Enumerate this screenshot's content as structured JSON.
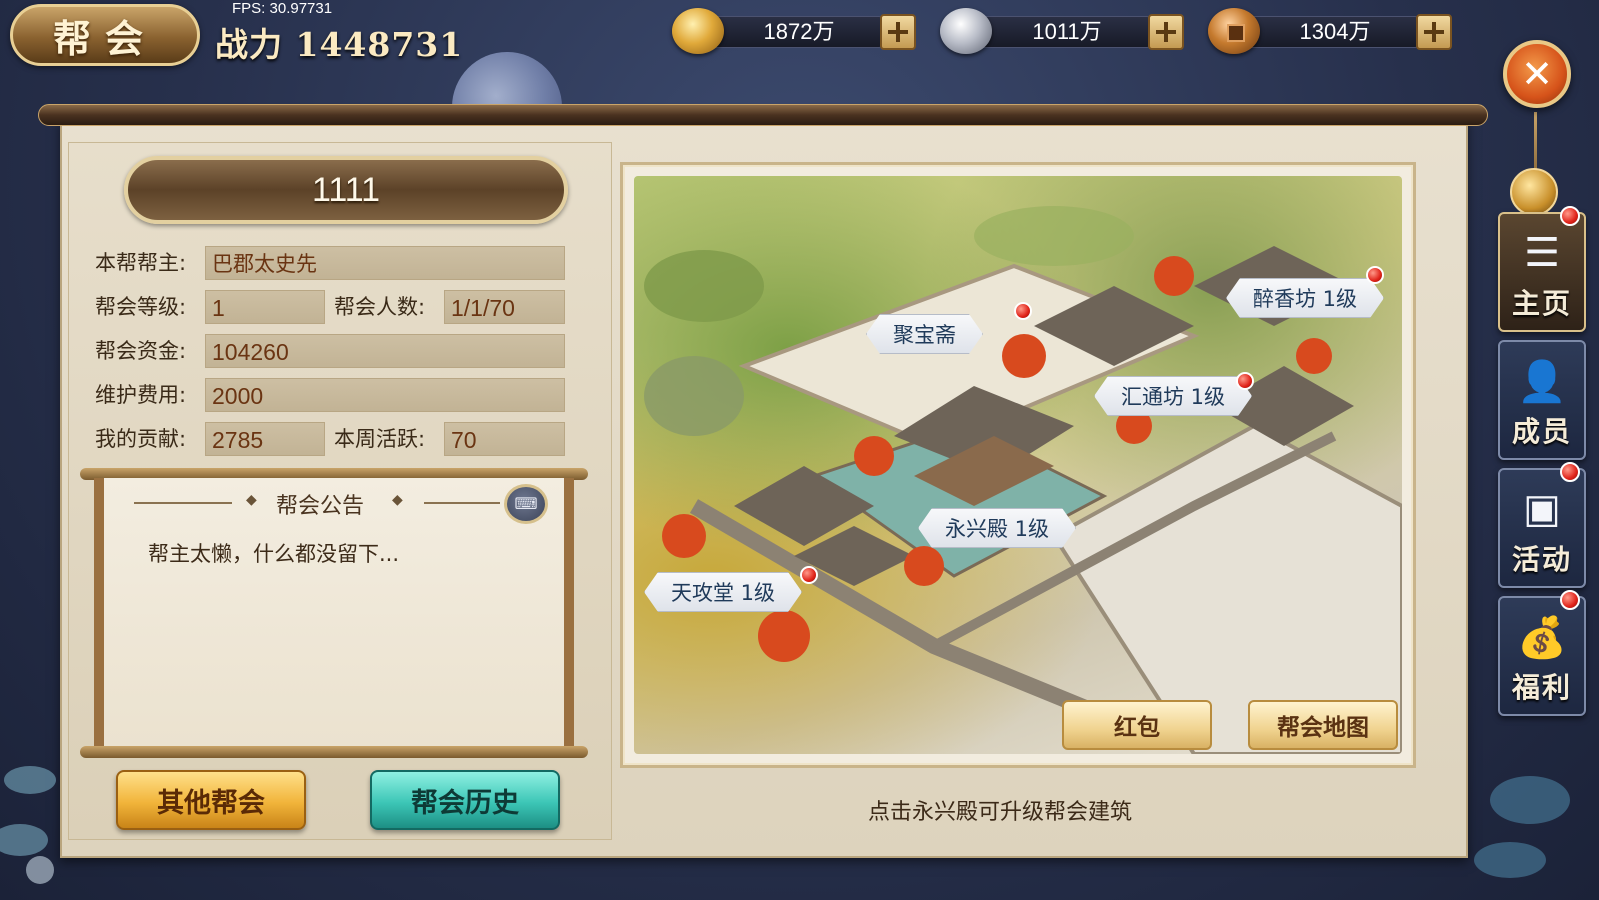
{
  "header": {
    "title": "帮会",
    "fps": "FPS: 30.97731",
    "power_label": "战力",
    "power_value": "1448731"
  },
  "currencies": [
    {
      "icon": "gold-ingot-icon",
      "value": "1872万"
    },
    {
      "icon": "silver-ingot-icon",
      "value": "1011万"
    },
    {
      "icon": "copper-coin-icon",
      "value": "1304万"
    }
  ],
  "guild": {
    "name": "1111",
    "leader_label": "本帮帮主:",
    "leader": "巴郡太史先",
    "level_label": "帮会等级:",
    "level": "1",
    "members_label": "帮会人数:",
    "members": "1/1/70",
    "funds_label": "帮会资金:",
    "funds": "104260",
    "upkeep_label": "维护费用:",
    "upkeep": "2000",
    "contribution_label": "我的贡献:",
    "contribution": "2785",
    "weekly_label": "本周活跃:",
    "weekly": "70"
  },
  "notice": {
    "title": "帮会公告",
    "text": "帮主太懒，什么都没留下..."
  },
  "buttons": {
    "other_guilds": "其他帮会",
    "guild_history": "帮会历史",
    "red_packet": "红包",
    "guild_map": "帮会地图"
  },
  "buildings": [
    {
      "name": "醉香坊 1级",
      "badge": true
    },
    {
      "name": "聚宝斋",
      "badge": true
    },
    {
      "name": "汇通坊 1级",
      "badge": true
    },
    {
      "name": "永兴殿 1级",
      "badge": false
    },
    {
      "name": "天攻堂 1级",
      "badge": true
    }
  ],
  "tip": "点击永兴殿可升级帮会建筑",
  "side_nav": [
    {
      "label": "主页",
      "icon": "list-icon",
      "active": true,
      "badge": true
    },
    {
      "label": "成员",
      "icon": "member-icon",
      "active": false,
      "badge": false
    },
    {
      "label": "活动",
      "icon": "chest-icon",
      "active": false,
      "badge": true
    },
    {
      "label": "福利",
      "icon": "money-bag-icon",
      "active": false,
      "badge": true
    }
  ],
  "colors": {
    "accent_gold": "#f1b43a",
    "accent_teal": "#3cc6b6",
    "badge_red": "#e0231a",
    "label_blue": "#1f3a5a"
  }
}
